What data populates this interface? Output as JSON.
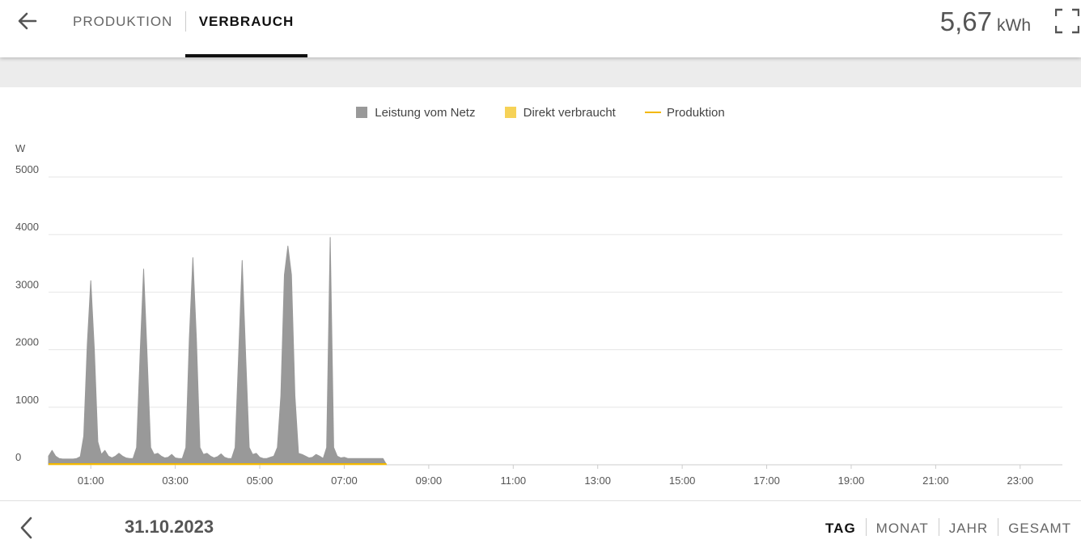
{
  "header": {
    "tabs": [
      {
        "label": "PRODUKTION",
        "active": false
      },
      {
        "label": "VERBRAUCH",
        "active": true
      }
    ],
    "total_value": "5,67",
    "total_unit": "kWh"
  },
  "icons": {
    "back": "arrow-left-icon",
    "fullscreen": "fullscreen-icon",
    "previous": "chevron-left-icon"
  },
  "legend": [
    {
      "label": "Leistung vom Netz",
      "color": "#999999",
      "kind": "area"
    },
    {
      "label": "Direkt verbraucht",
      "color": "#f6d257",
      "kind": "area"
    },
    {
      "label": "Produktion",
      "color": "#f3b800",
      "kind": "line"
    }
  ],
  "chart_data": {
    "type": "area",
    "ylabel": "W",
    "ylim": [
      0,
      5000
    ],
    "yticks": [
      0,
      1000,
      2000,
      3000,
      4000,
      5000
    ],
    "xlim": [
      "00:00",
      "24:00"
    ],
    "xticks": [
      "01:00",
      "03:00",
      "05:00",
      "07:00",
      "09:00",
      "11:00",
      "13:00",
      "15:00",
      "17:00",
      "19:00",
      "21:00",
      "23:00"
    ],
    "grid": true,
    "legend_position": "top",
    "series": [
      {
        "name": "Leistung vom Netz",
        "color": "#999999",
        "x": [
          "00:00",
          "00:05",
          "00:10",
          "00:15",
          "00:20",
          "00:25",
          "00:30",
          "00:35",
          "00:40",
          "00:45",
          "00:50",
          "00:55",
          "01:00",
          "01:05",
          "01:10",
          "01:15",
          "01:20",
          "01:25",
          "01:30",
          "01:35",
          "01:40",
          "01:45",
          "01:50",
          "01:55",
          "02:00",
          "02:05",
          "02:10",
          "02:15",
          "02:20",
          "02:25",
          "02:30",
          "02:35",
          "02:40",
          "02:45",
          "02:50",
          "02:55",
          "03:00",
          "03:05",
          "03:10",
          "03:15",
          "03:20",
          "03:25",
          "03:30",
          "03:35",
          "03:40",
          "03:45",
          "03:50",
          "03:55",
          "04:00",
          "04:05",
          "04:10",
          "04:15",
          "04:20",
          "04:25",
          "04:30",
          "04:35",
          "04:40",
          "04:45",
          "04:50",
          "04:55",
          "05:00",
          "05:05",
          "05:10",
          "05:15",
          "05:20",
          "05:25",
          "05:30",
          "05:35",
          "05:40",
          "05:45",
          "05:50",
          "05:55",
          "06:00",
          "06:05",
          "06:10",
          "06:15",
          "06:20",
          "06:25",
          "06:30",
          "06:35",
          "06:40",
          "06:45",
          "06:50",
          "06:55",
          "07:00",
          "07:05",
          "07:10",
          "07:15",
          "07:20",
          "07:25",
          "07:30",
          "07:35",
          "07:40",
          "07:45",
          "07:50",
          "07:55",
          "08:00"
        ],
        "values": [
          150,
          250,
          150,
          110,
          100,
          100,
          100,
          100,
          110,
          140,
          500,
          2100,
          3200,
          2000,
          400,
          180,
          250,
          150,
          120,
          150,
          200,
          150,
          120,
          110,
          110,
          300,
          1900,
          3400,
          1900,
          300,
          180,
          200,
          150,
          120,
          130,
          180,
          120,
          110,
          110,
          300,
          2200,
          3600,
          2200,
          300,
          180,
          200,
          150,
          120,
          140,
          190,
          130,
          110,
          110,
          300,
          1900,
          3550,
          1900,
          300,
          180,
          200,
          130,
          110,
          110,
          130,
          150,
          300,
          1200,
          3300,
          3800,
          3300,
          1200,
          200,
          180,
          150,
          120,
          130,
          180,
          150,
          110,
          300,
          3950,
          300,
          150,
          120,
          130,
          110,
          110,
          110,
          110,
          110,
          110,
          110,
          110,
          110,
          110,
          110,
          0
        ],
        "note": "sampled every 5 min; peaks at ~00:58 3200, ~02:19 3400, ~03:37 3600, ~04:52 3550, ~06:17 3750, ~07:36 3950"
      },
      {
        "name": "Direkt verbraucht",
        "color": "#f6d257",
        "x": [
          "00:00",
          "08:00"
        ],
        "values": [
          0,
          0
        ]
      },
      {
        "name": "Produktion",
        "color": "#f3b800",
        "x": [
          "00:00",
          "08:00"
        ],
        "values": [
          0,
          0
        ]
      }
    ]
  },
  "footer": {
    "date": "31.10.2023",
    "ranges": [
      {
        "label": "TAG",
        "active": true
      },
      {
        "label": "MONAT",
        "active": false
      },
      {
        "label": "JAHR",
        "active": false
      },
      {
        "label": "GESAMT",
        "active": false
      }
    ]
  }
}
